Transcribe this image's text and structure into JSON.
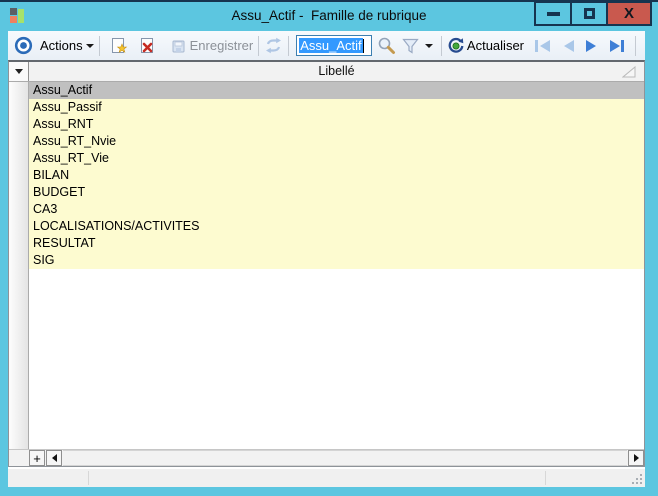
{
  "window": {
    "title": "Assu_Actif -  Famille de rubrique",
    "close_glyph": "X"
  },
  "toolbar": {
    "actions_label": "Actions",
    "enregistrer_label": "Enregistrer",
    "actualiser_label": "Actualiser",
    "search_value": "Assu_Actif"
  },
  "table": {
    "header_label": "Libellé",
    "rows": [
      "Assu_Actif",
      "Assu_Passif",
      "Assu_RNT",
      "Assu_RT_Nvie",
      "Assu_RT_Vie",
      "BILAN",
      "BUDGET",
      "CA3",
      "LOCALISATIONS/ACTIVITES",
      "RESULTAT",
      "SIG"
    ],
    "selected_index": 0
  },
  "scrollbar": {
    "add_label": "+"
  },
  "colors": {
    "titlebar_teal": "#5CC6E0",
    "close_salmon": "#C9594E",
    "row_yellow": "#FDFBD0",
    "row_selected": "#C0C0C0",
    "selection_blue": "#3399FF",
    "nav_enabled": "#3E7FD6",
    "nav_disabled": "#A9C7E8"
  }
}
